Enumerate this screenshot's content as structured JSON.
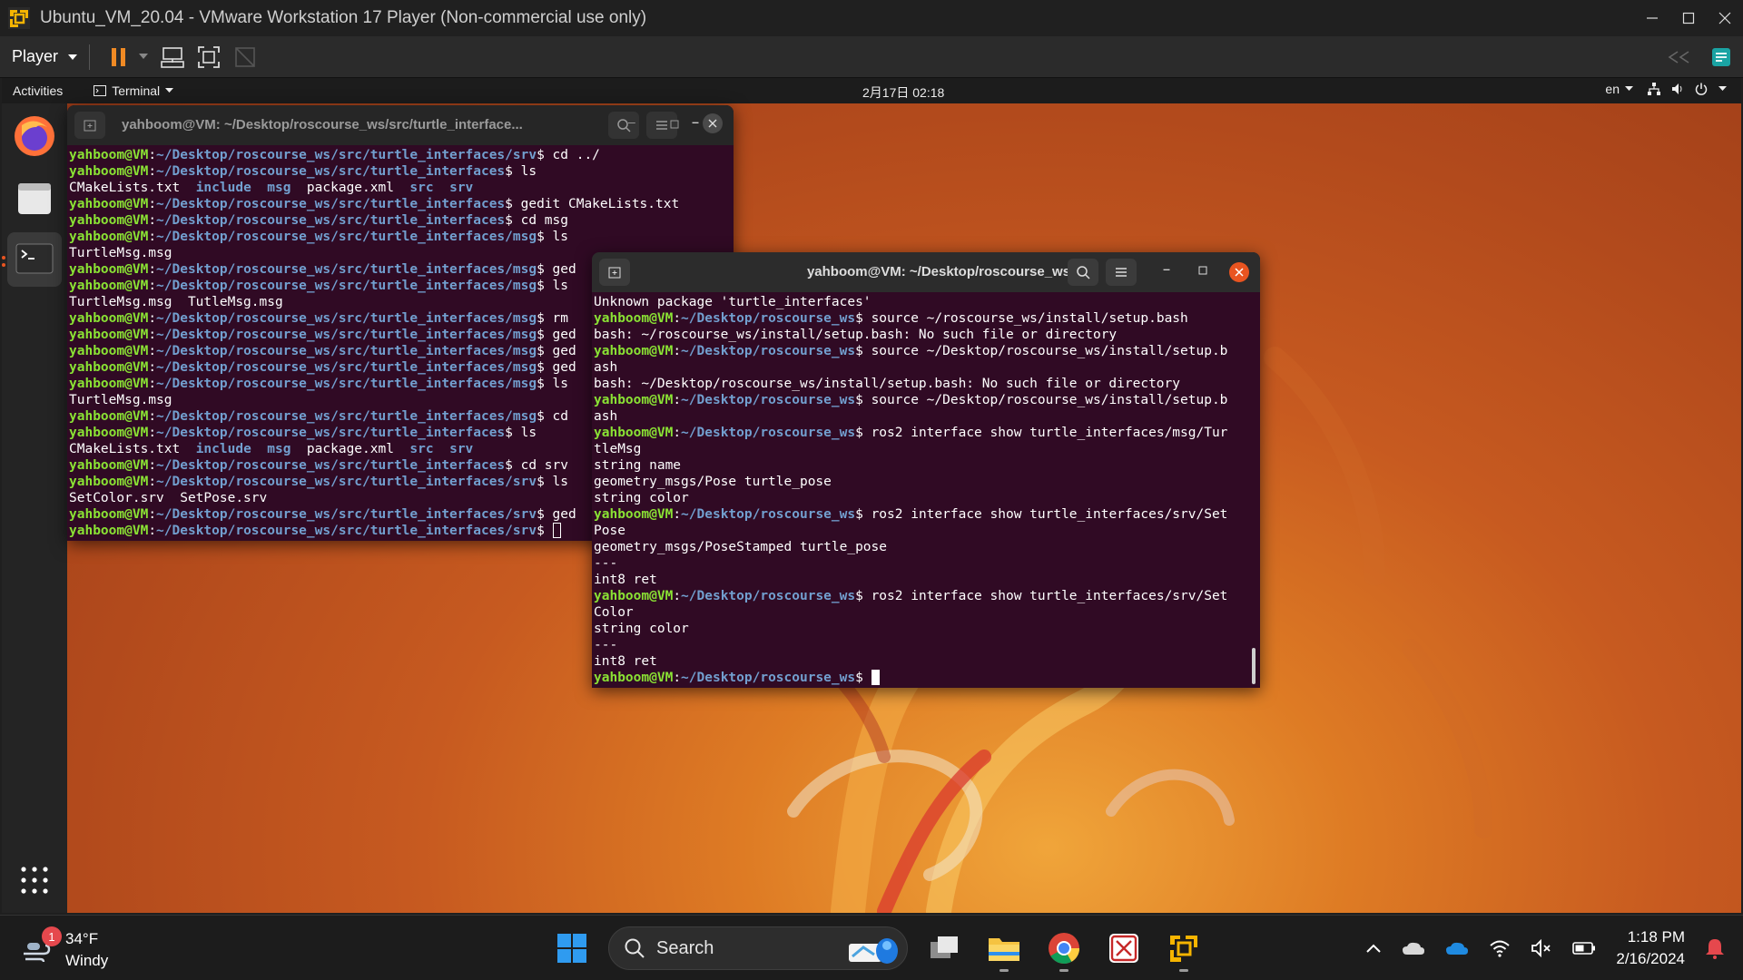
{
  "vmware": {
    "title": "Ubuntu_VM_20.04 - VMware Workstation 17 Player (Non-commercial use only)",
    "player_label": "Player"
  },
  "ubuntu_topbar": {
    "activities": "Activities",
    "app_menu": "Terminal",
    "clock": "2月17日  02:18",
    "language": "en"
  },
  "dock": {
    "items": [
      "firefox",
      "files",
      "terminal",
      "show-applications"
    ]
  },
  "terminal_back": {
    "title": "yahboom@VM: ~/Desktop/roscourse_ws/src/turtle_interface...",
    "lines": [
      {
        "user": "yahboom@VM",
        "path": "~/Desktop/roscourse_ws/src/turtle_interfaces/srv",
        "cmd": "$ cd ../"
      },
      {
        "user": "yahboom@VM",
        "path": "~/Desktop/roscourse_ws/src/turtle_interfaces",
        "cmd": "$ ls"
      },
      {
        "out": "CMakeLists.txt  ",
        "dirs": [
          "include",
          "msg"
        ],
        "mid": "  package.xml  ",
        "dirs2": [
          "src",
          "srv"
        ]
      },
      {
        "user": "yahboom@VM",
        "path": "~/Desktop/roscourse_ws/src/turtle_interfaces",
        "cmd": "$ gedit CMakeLists.txt"
      },
      {
        "user": "yahboom@VM",
        "path": "~/Desktop/roscourse_ws/src/turtle_interfaces",
        "cmd": "$ cd msg"
      },
      {
        "user": "yahboom@VM",
        "path": "~/Desktop/roscourse_ws/src/turtle_interfaces/msg",
        "cmd": "$ ls"
      },
      {
        "out": "TurtleMsg.msg"
      },
      {
        "user": "yahboom@VM",
        "path": "~/Desktop/roscourse_ws/src/turtle_interfaces/msg",
        "cmd": "$ ged"
      },
      {
        "user": "yahboom@VM",
        "path": "~/Desktop/roscourse_ws/src/turtle_interfaces/msg",
        "cmd": "$ ls"
      },
      {
        "out": "TurtleMsg.msg  TutleMsg.msg"
      },
      {
        "user": "yahboom@VM",
        "path": "~/Desktop/roscourse_ws/src/turtle_interfaces/msg",
        "cmd": "$ rm"
      },
      {
        "user": "yahboom@VM",
        "path": "~/Desktop/roscourse_ws/src/turtle_interfaces/msg",
        "cmd": "$ ged"
      },
      {
        "user": "yahboom@VM",
        "path": "~/Desktop/roscourse_ws/src/turtle_interfaces/msg",
        "cmd": "$ ged"
      },
      {
        "user": "yahboom@VM",
        "path": "~/Desktop/roscourse_ws/src/turtle_interfaces/msg",
        "cmd": "$ ged"
      },
      {
        "user": "yahboom@VM",
        "path": "~/Desktop/roscourse_ws/src/turtle_interfaces/msg",
        "cmd": "$ ls"
      },
      {
        "out": "TurtleMsg.msg"
      },
      {
        "user": "yahboom@VM",
        "path": "~/Desktop/roscourse_ws/src/turtle_interfaces/msg",
        "cmd": "$ cd"
      },
      {
        "user": "yahboom@VM",
        "path": "~/Desktop/roscourse_ws/src/turtle_interfaces",
        "cmd": "$ ls"
      },
      {
        "out": "CMakeLists.txt  ",
        "dirs": [
          "include",
          "msg"
        ],
        "mid": "  package.xml  ",
        "dirs2": [
          "src",
          "srv"
        ]
      },
      {
        "user": "yahboom@VM",
        "path": "~/Desktop/roscourse_ws/src/turtle_interfaces",
        "cmd": "$ cd srv"
      },
      {
        "user": "yahboom@VM",
        "path": "~/Desktop/roscourse_ws/src/turtle_interfaces/srv",
        "cmd": "$ ls"
      },
      {
        "out": "SetColor.srv  SetPose.srv"
      },
      {
        "user": "yahboom@VM",
        "path": "~/Desktop/roscourse_ws/src/turtle_interfaces/srv",
        "cmd": "$ ged"
      },
      {
        "user": "yahboom@VM",
        "path": "~/Desktop/roscourse_ws/src/turtle_interfaces/srv",
        "cmd": "$ ",
        "cursor": "hollow"
      }
    ]
  },
  "terminal_front": {
    "title": "yahboom@VM: ~/Desktop/roscourse_ws",
    "lines": [
      {
        "out": "Unknown package 'turtle_interfaces'"
      },
      {
        "user": "yahboom@VM",
        "path": "~/Desktop/roscourse_ws",
        "cmd": "$ source ~/roscourse_ws/install/setup.bash"
      },
      {
        "out": "bash: ~/roscourse_ws/install/setup.bash: No such file or directory"
      },
      {
        "user": "yahboom@VM",
        "path": "~/Desktop/roscourse_ws",
        "cmd": "$ source ~/Desktop/roscourse_ws/install/setup.b"
      },
      {
        "out": "ash"
      },
      {
        "out": "bash: ~/Desktop/roscourse_ws/install/setup.bash: No such file or directory"
      },
      {
        "user": "yahboom@VM",
        "path": "~/Desktop/roscourse_ws",
        "cmd": "$ source ~/Desktop/roscourse_ws/install/setup.b"
      },
      {
        "out": "ash"
      },
      {
        "user": "yahboom@VM",
        "path": "~/Desktop/roscourse_ws",
        "cmd": "$ ros2 interface show turtle_interfaces/msg/Tur"
      },
      {
        "out": "tleMsg"
      },
      {
        "out": "string name"
      },
      {
        "out": "geometry_msgs/Pose turtle_pose"
      },
      {
        "out": "string color"
      },
      {
        "user": "yahboom@VM",
        "path": "~/Desktop/roscourse_ws",
        "cmd": "$ ros2 interface show turtle_interfaces/srv/Set"
      },
      {
        "out": "Pose"
      },
      {
        "out": "geometry_msgs/PoseStamped turtle_pose"
      },
      {
        "out": "---"
      },
      {
        "out": "int8 ret"
      },
      {
        "user": "yahboom@VM",
        "path": "~/Desktop/roscourse_ws",
        "cmd": "$ ros2 interface show turtle_interfaces/srv/Set"
      },
      {
        "out": "Color"
      },
      {
        "out": "string color"
      },
      {
        "out": "---"
      },
      {
        "out": "int8 ret"
      },
      {
        "user": "yahboom@VM",
        "path": "~/Desktop/roscourse_ws",
        "cmd": "$ ",
        "cursor": "solid"
      }
    ]
  },
  "taskbar": {
    "weather_temp": "34°F",
    "weather_desc": "Windy",
    "weather_badge": "1",
    "search_label": "Search",
    "time": "1:18 PM",
    "date": "2/16/2024"
  },
  "colors": {
    "terminal_bg": "#300a24",
    "prompt_user": "#8ae234",
    "prompt_path": "#729fcf",
    "close_button": "#e95420"
  }
}
